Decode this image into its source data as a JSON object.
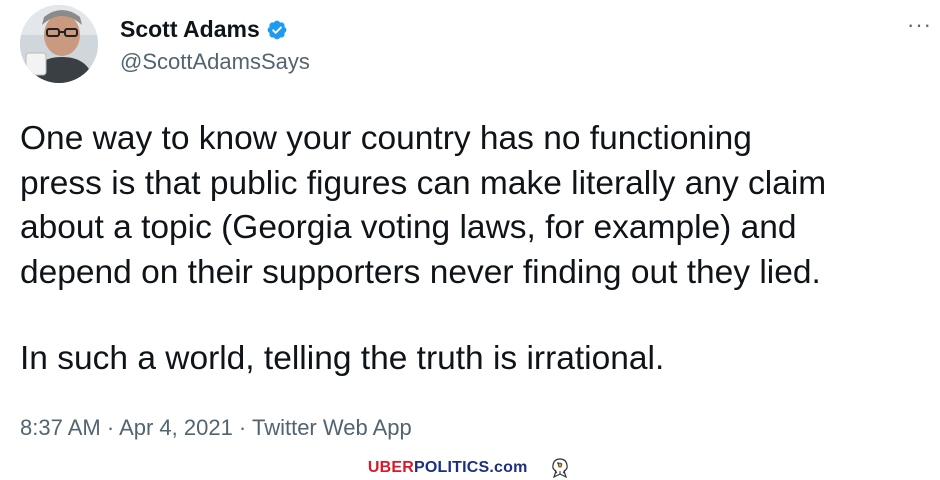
{
  "tweet": {
    "author": {
      "display_name": "Scott Adams",
      "handle": "@ScottAdamsSays",
      "verified": true,
      "avatar_icon": "avatar-photo"
    },
    "more_label": "···",
    "text_lines": [
      "One way to know your country has no functioning",
      "press is that public figures can make literally any claim",
      "about a topic (Georgia voting laws, for example) and",
      "depend on their supporters never finding out they lied."
    ],
    "text_line_final": "In such a world, telling the truth is irrational.",
    "meta": {
      "time": "8:37 AM",
      "sep1": " · ",
      "date": "Apr 4, 2021",
      "sep2": " · ",
      "source": "Twitter Web App"
    }
  },
  "watermark": {
    "part_red": "UBER",
    "part_blue": "POLITICS.com",
    "icon": "eagle-icon"
  },
  "colors": {
    "text": "#0f1419",
    "muted": "#536471",
    "verified": "#1d9bf0",
    "watermark_red": "#d8192a",
    "watermark_blue": "#1b2f82"
  }
}
